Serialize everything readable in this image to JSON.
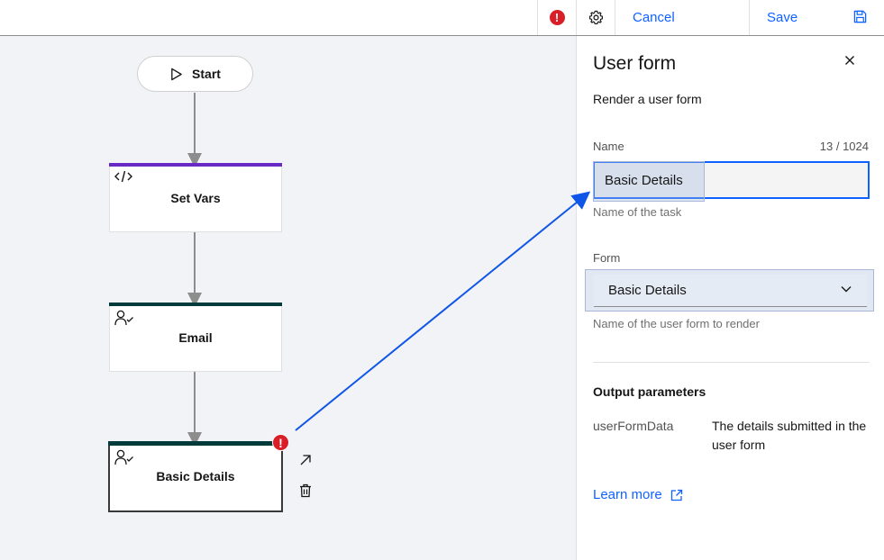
{
  "toolbar": {
    "error_badge": "!",
    "cancel_label": "Cancel",
    "save_label": "Save"
  },
  "canvas": {
    "start_label": "Start",
    "tasks": [
      {
        "label": "Set Vars",
        "icon": "code-icon",
        "accent": "#6929c4"
      },
      {
        "label": "Email",
        "icon": "user-check-icon",
        "accent": "#003a3a"
      },
      {
        "label": "Basic Details",
        "icon": "user-check-icon",
        "accent": "#003a3a",
        "selected": true
      }
    ],
    "task_error_badge": "!"
  },
  "panel": {
    "title": "User form",
    "description": "Render a user form",
    "name_label": "Name",
    "name_count": "13 / 1024",
    "name_value": "Basic Details",
    "name_helper": "Name of the task",
    "form_label": "Form",
    "form_value": "Basic Details",
    "form_helper": "Name of the user form to render",
    "output_title": "Output parameters",
    "output_key": "userFormData",
    "output_value": "The details submitted in the user form",
    "learn_more": "Learn more"
  },
  "colors": {
    "accent_blue": "#0f62fe",
    "error_red": "#da1e28",
    "annotation_arrow": "#0f56e8"
  }
}
